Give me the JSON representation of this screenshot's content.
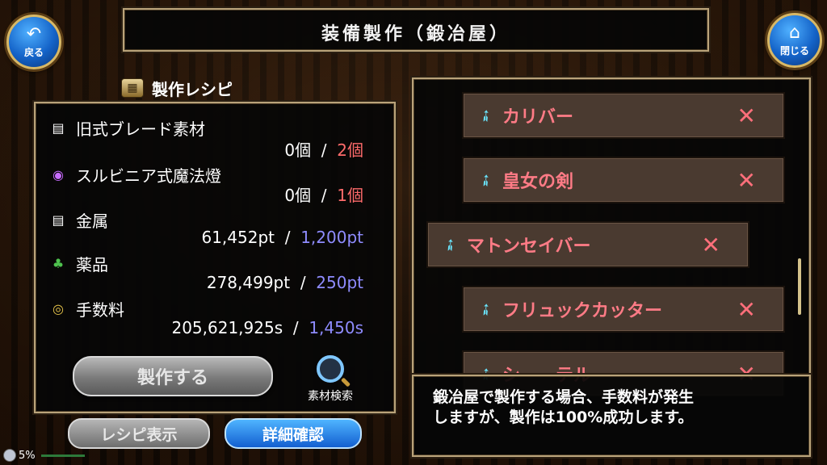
{
  "header": {
    "title": "装備製作（鍛冶屋）"
  },
  "nav": {
    "back": {
      "icon": "back-arrow-icon",
      "label": "戻る"
    },
    "close": {
      "icon": "home-icon",
      "label": "閉じる"
    }
  },
  "recipe": {
    "title": "製作レシピ",
    "materials": [
      {
        "name": "旧式ブレード素材",
        "icon": "material-box-icon",
        "have": "0個",
        "sep": "/",
        "need": "2個"
      },
      {
        "name": "スルビニア式魔法燈",
        "icon": "magic-lamp-icon",
        "have": "0個",
        "sep": "/",
        "need": "1個"
      },
      {
        "name": "金属",
        "icon": "metal-box-icon",
        "have": "61,452pt",
        "sep": "/",
        "need": "1,200pt"
      },
      {
        "name": "薬品",
        "icon": "herb-icon",
        "have": "278,499pt",
        "sep": "/",
        "need": "250pt"
      },
      {
        "name": "手数料",
        "icon": "coin-icon",
        "have": "205,621,925s",
        "sep": "/",
        "need": "1,450s"
      }
    ],
    "make_button": "製作する",
    "search_label": "素材検索"
  },
  "bottom_buttons": {
    "recipe_view": "レシピ表示",
    "detail": "詳細確認"
  },
  "weapons": [
    {
      "name": "カリバー",
      "icon": "sword-icon"
    },
    {
      "name": "皇女の剣",
      "icon": "sword-icon"
    },
    {
      "name": "マトンセイバー",
      "icon": "sword-icon",
      "selected": true
    },
    {
      "name": "フリュックカッター",
      "icon": "sword-icon"
    },
    {
      "name": "シ　　テル",
      "icon": "sword-icon"
    }
  ],
  "message": {
    "line1": "鍛冶屋で製作する場合、手数料が発生",
    "line2": "しますが、製作は100%成功します。"
  },
  "status": {
    "battery": "5%"
  },
  "colors": {
    "have_ok": "#ffffff",
    "need_short": "#ff6b6b",
    "need_ok": "#8f8cff",
    "weapon_name": "#ff7b86"
  }
}
